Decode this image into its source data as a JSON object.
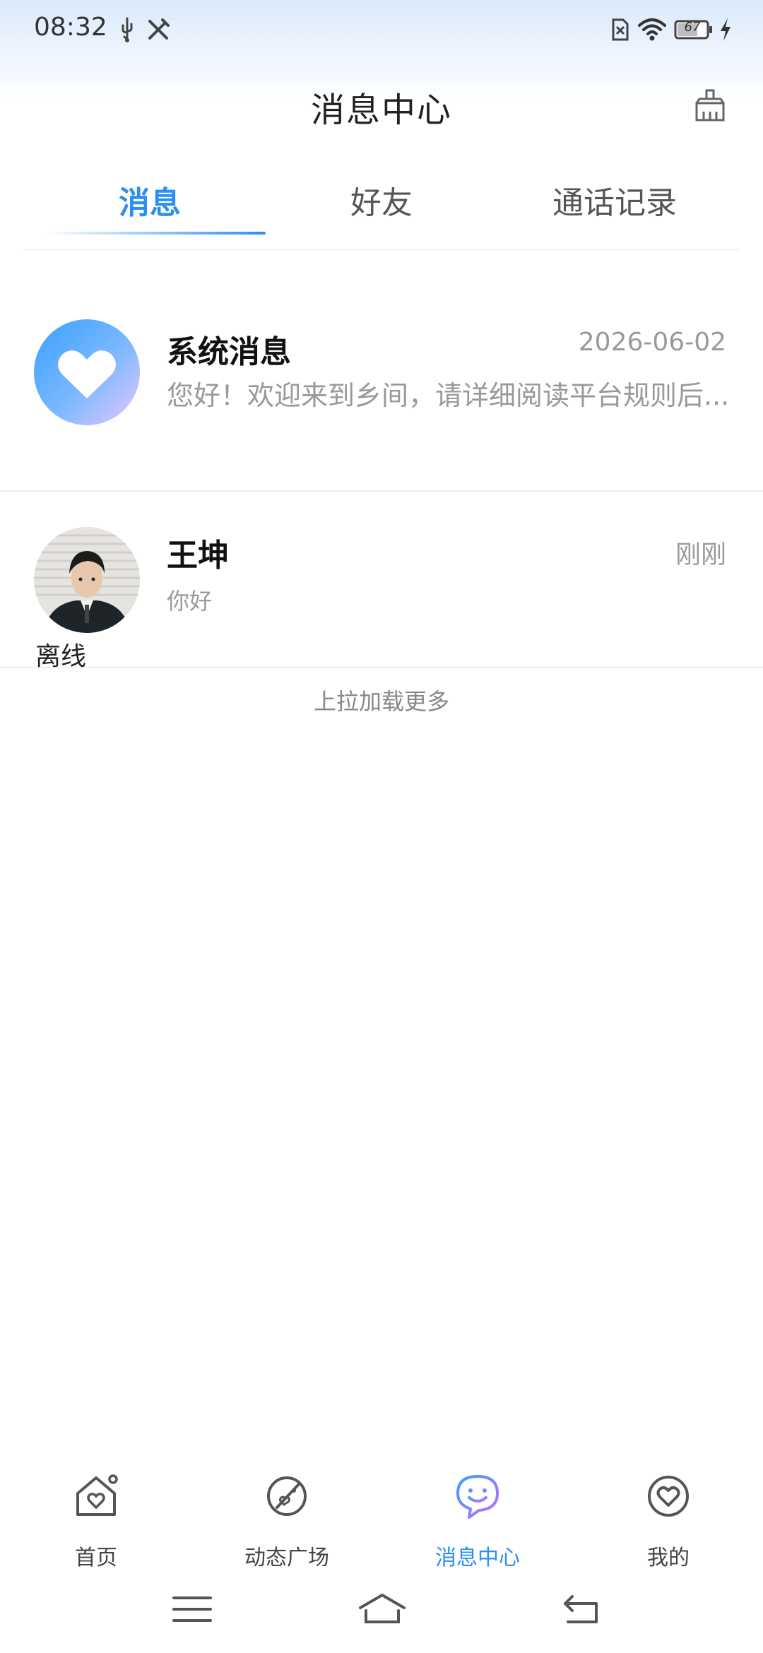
{
  "status_bar": {
    "time": "08:32",
    "battery": "67",
    "icons": [
      "usb-icon",
      "tools-icon",
      "sim-icon",
      "wifi-icon",
      "battery-icon",
      "charging-icon"
    ]
  },
  "header": {
    "title": "消息中心",
    "clear_icon": "clear-icon"
  },
  "tabs": [
    {
      "label": "消息",
      "active": true
    },
    {
      "label": "好友",
      "active": false
    },
    {
      "label": "通话记录",
      "active": false
    }
  ],
  "accent_color": "#2b8ff0",
  "messages": [
    {
      "name": "系统消息",
      "time": "2026-06-02",
      "preview": "您好！欢迎来到乡间，请详细阅读平台规则后...",
      "avatar": "heart-icon"
    },
    {
      "name": "王坤",
      "time": "刚刚",
      "preview": "你好",
      "status": "离线",
      "avatar": "user-avatar"
    }
  ],
  "load_more": "上拉加载更多",
  "bottom_nav": [
    {
      "label": "首页",
      "icon": "home-icon",
      "active": false
    },
    {
      "label": "动态广场",
      "icon": "planet-icon",
      "active": false
    },
    {
      "label": "消息中心",
      "icon": "chat-smile-icon",
      "active": true
    },
    {
      "label": "我的",
      "icon": "profile-heart-icon",
      "active": false
    }
  ],
  "system_nav": [
    "menu-icon",
    "home-outline-icon",
    "back-icon"
  ]
}
